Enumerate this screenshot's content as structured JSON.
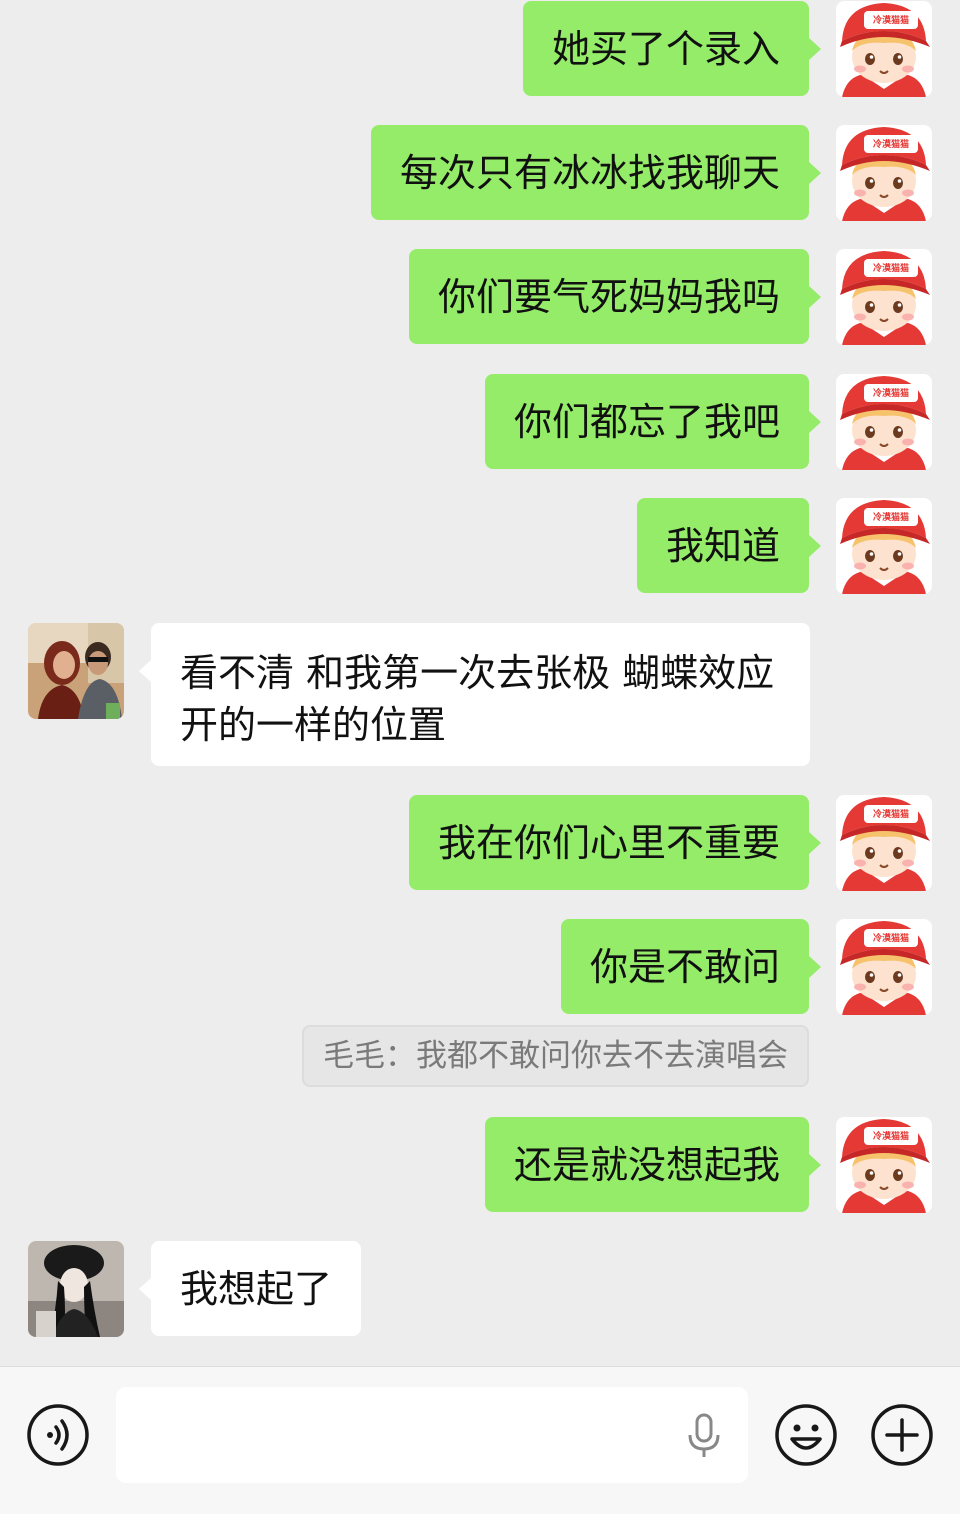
{
  "colors": {
    "sent_bubble": "#95ec69",
    "received_bubble": "#ffffff",
    "background": "#ededed"
  },
  "messages": [
    {
      "side": "me",
      "text": "她买了个录入",
      "avatar": "red-cap-cartoon-boy"
    },
    {
      "side": "me",
      "text": "每次只有冰冰找我聊天",
      "avatar": "red-cap-cartoon-boy"
    },
    {
      "side": "me",
      "text": "你们要气死妈妈我吗",
      "avatar": "red-cap-cartoon-boy"
    },
    {
      "side": "me",
      "text": "你们都忘了我吧",
      "avatar": "red-cap-cartoon-boy"
    },
    {
      "side": "me",
      "text": "我知道",
      "avatar": "red-cap-cartoon-boy"
    },
    {
      "side": "them",
      "text": "看不清 和我第一次去张极 蝴蝶效应开的一样的位置",
      "avatar": "couple-photo"
    },
    {
      "side": "me",
      "text": "我在你们心里不重要",
      "avatar": "red-cap-cartoon-boy"
    },
    {
      "side": "me",
      "text": "你是不敢问",
      "avatar": "red-cap-cartoon-boy",
      "quote": "毛毛：我都不敢问你去不去演唱会"
    },
    {
      "side": "me",
      "text": "还是就没想起我",
      "avatar": "red-cap-cartoon-boy"
    },
    {
      "side": "them",
      "text": "我想起了",
      "avatar": "girl-black-hat-photo"
    }
  ],
  "avatar_badge_text": "冷漠猫猫",
  "toolbar": {
    "voice_icon": "voice-mode-icon",
    "mic_icon": "microphone-icon",
    "emoji_icon": "emoji-icon",
    "plus_icon": "plus-icon",
    "input_value": ""
  }
}
